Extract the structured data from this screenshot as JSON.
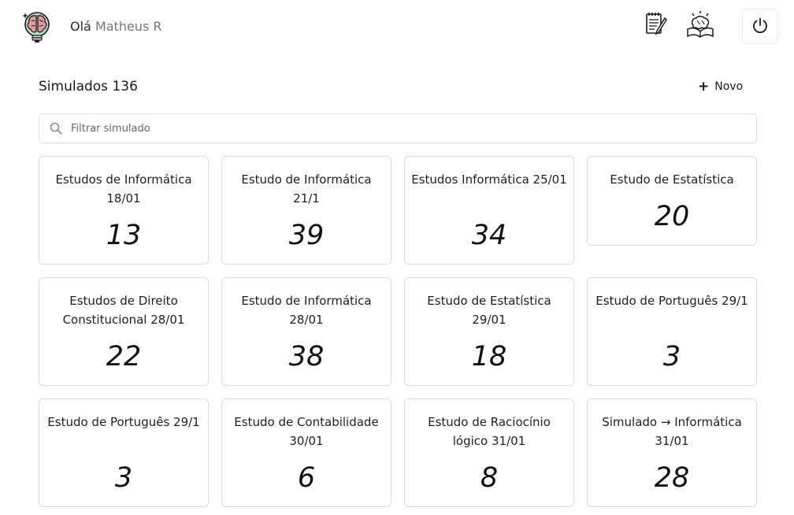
{
  "header": {
    "greeting_prefix": "Olá",
    "user_name": "Matheus R"
  },
  "page": {
    "title": "Simulados 136",
    "new_label": "Novo"
  },
  "search": {
    "placeholder": "Filtrar simulado",
    "value": ""
  },
  "cards": [
    {
      "title": "Estudos de Informática 18/01",
      "count": "13"
    },
    {
      "title": "Estudo de Informática 21/1",
      "count": "39"
    },
    {
      "title": "Estudos Informática 25/01",
      "count": "34"
    },
    {
      "title": "Estudo de Estatística",
      "count": "20"
    },
    {
      "title": "Estudos de Direito Constitucional 28/01",
      "count": "22"
    },
    {
      "title": "Estudo de Informática 28/01",
      "count": "38"
    },
    {
      "title": "Estudo de Estatística 29/01",
      "count": "18"
    },
    {
      "title": "Estudo de Português 29/1",
      "count": "3"
    },
    {
      "title": "Estudo de Português 29/1",
      "count": "3"
    },
    {
      "title": "Estudo de Contabilidade 30/01",
      "count": "6"
    },
    {
      "title": "Estudo de Raciocínio lógico 31/01",
      "count": "8"
    },
    {
      "title": "Simulado → Informática 31/01",
      "count": "28"
    }
  ],
  "icons": {
    "logo": "brain-lightbulb-icon",
    "notes": "notepad-pen-icon",
    "study": "brain-book-icon",
    "logout": "power-icon",
    "search": "search-icon",
    "new": "plus-icon"
  }
}
